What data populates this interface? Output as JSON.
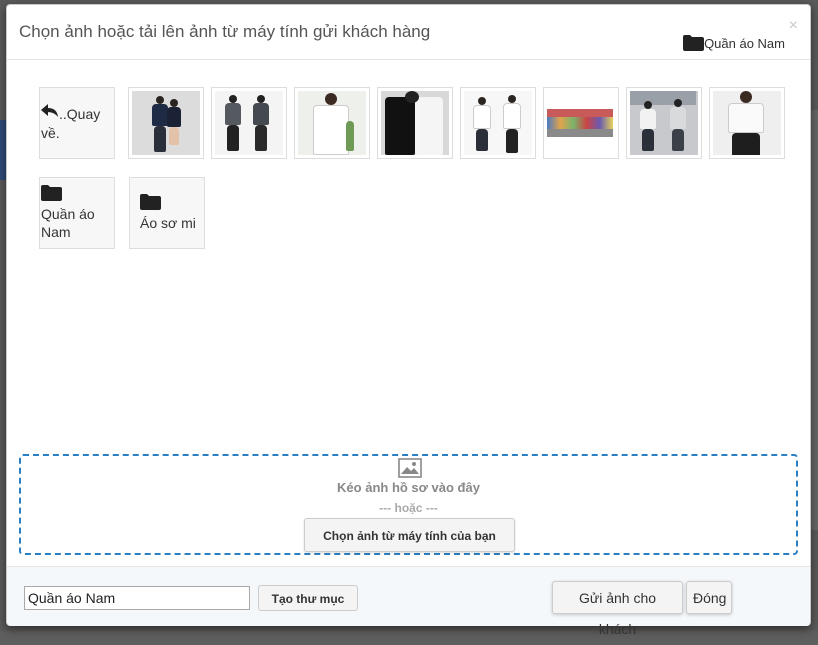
{
  "dialog": {
    "title": "Chọn ảnh hoặc tải lên ảnh từ máy tính gửi khách hàng",
    "close_symbol": "×",
    "current_folder": "Quần áo Nam"
  },
  "tiles": {
    "back_label": "..Quay về.",
    "images": [
      {
        "icon": "photo-couple"
      },
      {
        "icon": "photo-two-men"
      },
      {
        "icon": "photo-white-shirt"
      },
      {
        "icon": "photo-black-white-sweater"
      },
      {
        "icon": "photo-two-men-shirts"
      },
      {
        "icon": "photo-shop-display"
      },
      {
        "icon": "photo-men-casual"
      },
      {
        "icon": "photo-man-white-shirt"
      }
    ],
    "folders": [
      {
        "label": "Quần áo Nam"
      },
      {
        "label": "Áo sơ mi"
      }
    ]
  },
  "dropzone": {
    "text": "Kéo ảnh hồ sơ vào đây",
    "or_text": "--- hoặc ---",
    "choose_button": "Chọn ảnh từ máy tính của bạn"
  },
  "footer": {
    "folder_name_value": "Quần áo Nam",
    "create_folder_button": "Tạo thư mục",
    "send_button": "Gửi ảnh cho khách",
    "close_button": "Đóng"
  }
}
